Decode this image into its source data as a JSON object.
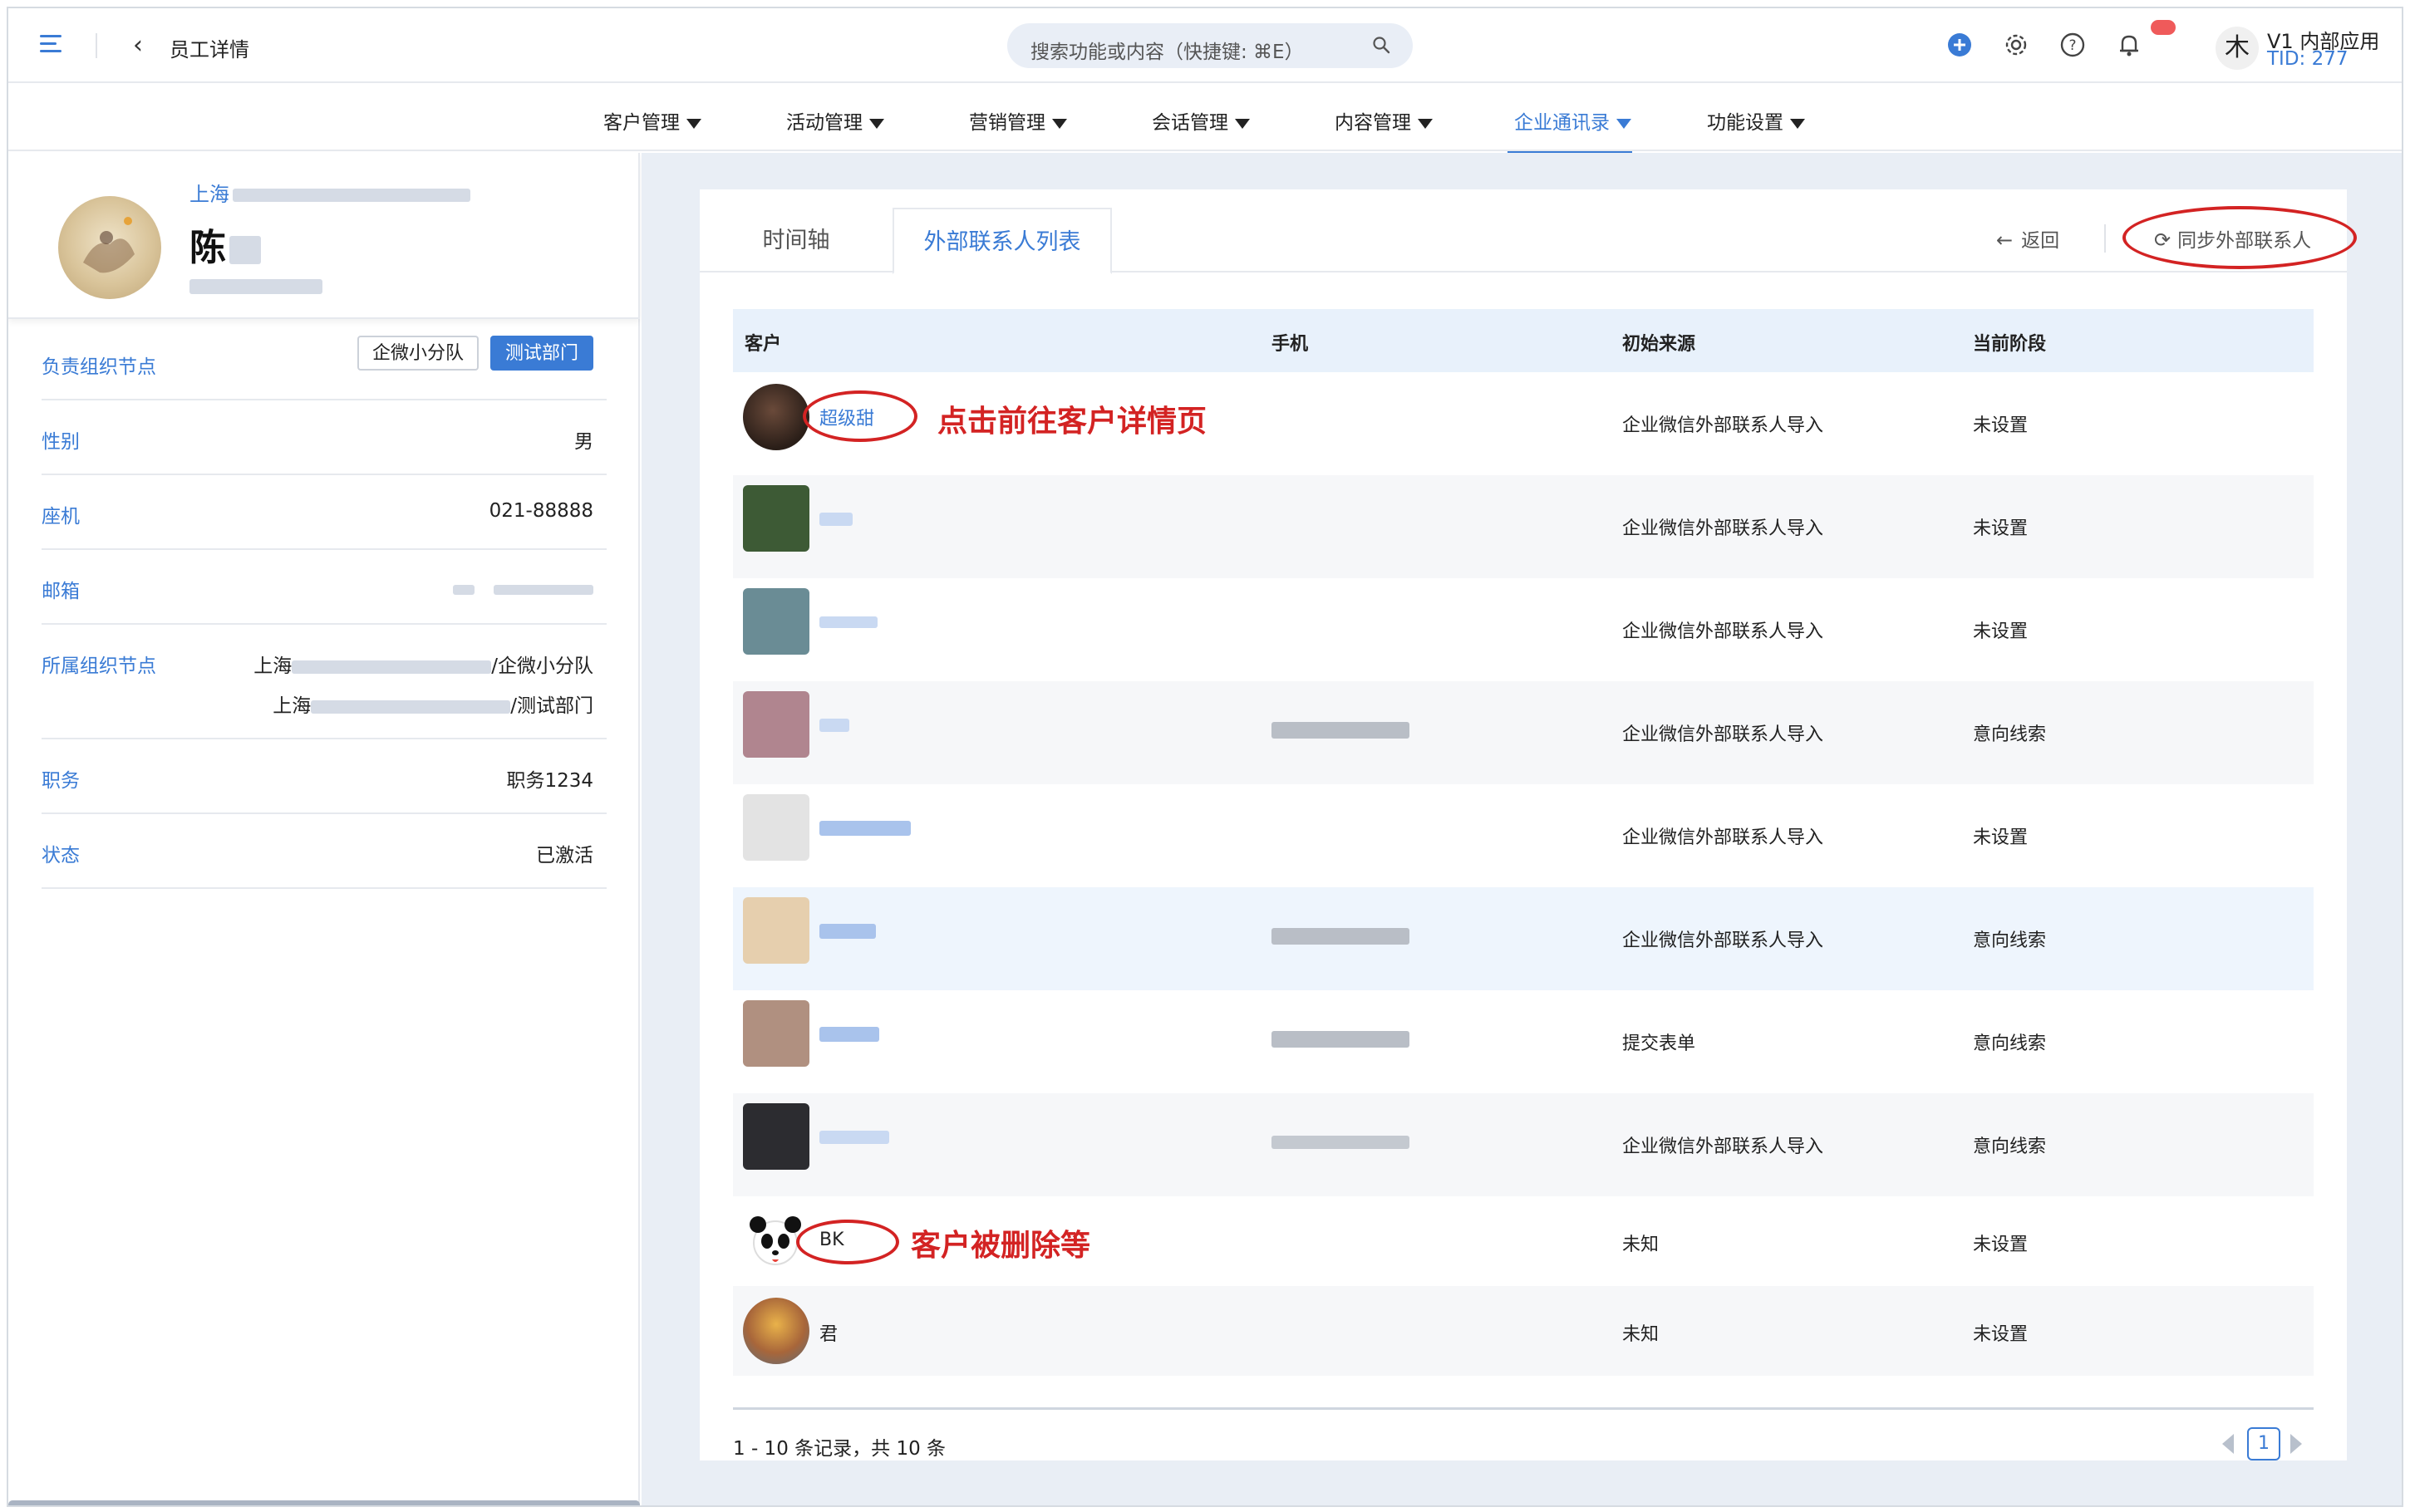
{
  "header": {
    "page_title": "员工详情",
    "search_placeholder": "搜索功能或内容（快捷键: ⌘E）",
    "app_avatar_char": "木",
    "app_name": "V1 内部应用",
    "app_tid": "TID: 277"
  },
  "nav": {
    "items": [
      {
        "label": "客户管理"
      },
      {
        "label": "活动管理"
      },
      {
        "label": "营销管理"
      },
      {
        "label": "会话管理"
      },
      {
        "label": "内容管理"
      },
      {
        "label": "企业通讯录"
      },
      {
        "label": "功能设置"
      }
    ],
    "active_index": 5
  },
  "profile": {
    "company_prefix": "上海",
    "name": "陈"
  },
  "info": {
    "org_label": "负责组织节点",
    "org_tags": [
      "企微小分队",
      "测试部门"
    ],
    "gender_label": "性别",
    "gender_value": "男",
    "phone_label": "座机",
    "phone_value": "021-88888",
    "email_label": "邮箱",
    "belong_label": "所属组织节点",
    "belong_line1_prefix": "上海",
    "belong_line1_suffix": "/企微小分队",
    "belong_line2_prefix": "上海",
    "belong_line2_suffix": "/测试部门",
    "title_label": "职务",
    "title_value": "职务1234",
    "status_label": "状态",
    "status_value": "已激活"
  },
  "tabs": {
    "timeline": "时间轴",
    "contacts": "外部联系人列表",
    "back": "返回",
    "sync": "同步外部联系人"
  },
  "table": {
    "headers": [
      "客户",
      "手机",
      "初始来源",
      "当前阶段"
    ],
    "rows": [
      {
        "name": "超级甜",
        "source": "企业微信外部联系人导入",
        "stage": "未设置"
      },
      {
        "name": "",
        "source": "企业微信外部联系人导入",
        "stage": "未设置"
      },
      {
        "name": "",
        "source": "企业微信外部联系人导入",
        "stage": "未设置"
      },
      {
        "name": "",
        "source": "企业微信外部联系人导入",
        "stage": "意向线索"
      },
      {
        "name": "",
        "source": "企业微信外部联系人导入",
        "stage": "未设置"
      },
      {
        "name": "",
        "source": "企业微信外部联系人导入",
        "stage": "意向线索"
      },
      {
        "name": "",
        "source": "提交表单",
        "stage": "意向线索"
      },
      {
        "name": "",
        "source": "企业微信外部联系人导入",
        "stage": "意向线索"
      },
      {
        "name": "BK",
        "source": "未知",
        "stage": "未设置"
      },
      {
        "name": "君",
        "source": "未知",
        "stage": "未设置"
      }
    ]
  },
  "annotations": {
    "click_detail": "点击前往客户详情页",
    "deleted": "客户被删除等"
  },
  "pagination": {
    "total_text": "1 - 10 条记录，共 10 条",
    "current_page": "1"
  },
  "colors": {
    "accent": "#3a7bd5",
    "annotation": "#d32323",
    "content_bg": "#e9eef5"
  }
}
